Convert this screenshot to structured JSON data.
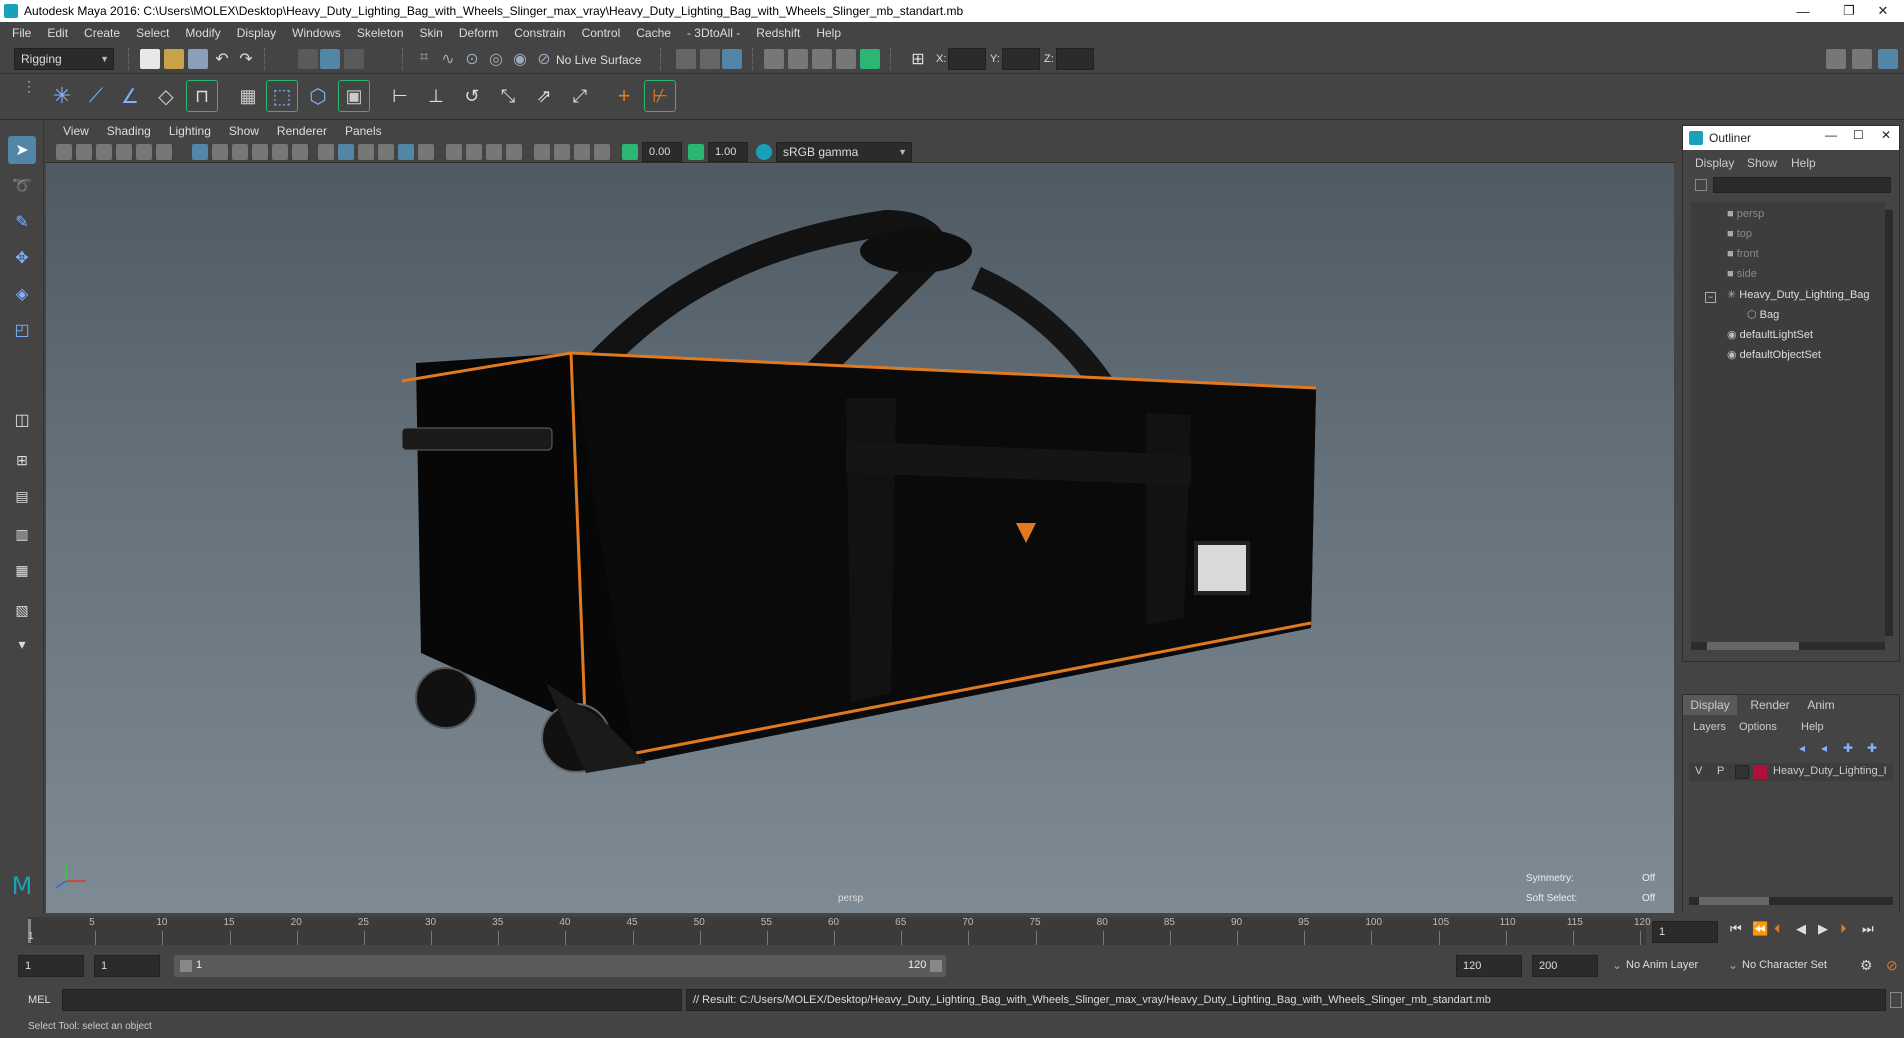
{
  "window": {
    "title": "Autodesk Maya 2016: C:\\Users\\MOLEX\\Desktop\\Heavy_Duty_Lighting_Bag_with_Wheels_Slinger_max_vray\\Heavy_Duty_Lighting_Bag_with_Wheels_Slinger_mb_standart.mb",
    "minimize": "—",
    "restore": "❐",
    "close": "✕"
  },
  "menubar": [
    "File",
    "Edit",
    "Create",
    "Select",
    "Modify",
    "Display",
    "Windows",
    "Skeleton",
    "Skin",
    "Deform",
    "Constrain",
    "Control",
    "Cache",
    "- 3DtoAll -",
    "Redshift",
    "Help"
  ],
  "statusline": {
    "mode": "Rigging",
    "live_surface": "No Live Surface",
    "x_label": "X:",
    "y_label": "Y:",
    "z_label": "Z:"
  },
  "viewport": {
    "menu": [
      "View",
      "Shading",
      "Lighting",
      "Show",
      "Renderer",
      "Panels"
    ],
    "exposure": "0.00",
    "gamma": "1.00",
    "color_space": "sRGB gamma",
    "camera_label": "persp",
    "hud": {
      "symmetry_label": "Symmetry:",
      "symmetry_value": "Off",
      "soft_select_label": "Soft Select:",
      "soft_select_value": "Off"
    }
  },
  "outliner": {
    "title": "Outliner",
    "menu": [
      "Display",
      "Show",
      "Help"
    ],
    "items": [
      {
        "label": "persp",
        "icon": "camera-icon",
        "dim": true
      },
      {
        "label": "top",
        "icon": "camera-icon",
        "dim": true
      },
      {
        "label": "front",
        "icon": "camera-icon",
        "dim": true
      },
      {
        "label": "side",
        "icon": "camera-icon",
        "dim": true
      },
      {
        "label": "Heavy_Duty_Lighting_Bag",
        "icon": "group-icon",
        "dim": false
      },
      {
        "label": "Bag",
        "icon": "mesh-icon",
        "dim": false
      },
      {
        "label": "defaultLightSet",
        "icon": "set-icon",
        "dim": false
      },
      {
        "label": "defaultObjectSet",
        "icon": "set-icon",
        "dim": false
      }
    ]
  },
  "layers": {
    "tabs": [
      "Display",
      "Render",
      "Anim"
    ],
    "menu": [
      "Layers",
      "Options",
      "Help"
    ],
    "layer": {
      "v": "V",
      "p": "P",
      "name": "Heavy_Duty_Lighting_I",
      "color": "#b0103a"
    }
  },
  "timeline": {
    "ticks": [
      "5",
      "10",
      "15",
      "20",
      "25",
      "30",
      "35",
      "40",
      "45",
      "50",
      "55",
      "60",
      "65",
      "70",
      "75",
      "80",
      "85",
      "90",
      "95",
      "100",
      "105",
      "110",
      "115",
      "120"
    ],
    "current_frame_marker": "1",
    "current_frame": "1"
  },
  "range": {
    "start": "1",
    "playback_start": "1",
    "slider_start": "1",
    "slider_end": "120",
    "playback_end": "120",
    "end": "200",
    "anim_layer": "No Anim Layer",
    "character_set": "No Character Set"
  },
  "cmdline": {
    "lang": "MEL",
    "result": "// Result: C:/Users/MOLEX/Desktop/Heavy_Duty_Lighting_Bag_with_Wheels_Slinger_max_vray/Heavy_Duty_Lighting_Bag_with_Wheels_Slinger_mb_standart.mb"
  },
  "helpline": "Select Tool: select an object",
  "colors": {
    "accent": "#5285a6",
    "bag_trim": "#e07a20",
    "maya_teal": "#1aa0b8"
  }
}
